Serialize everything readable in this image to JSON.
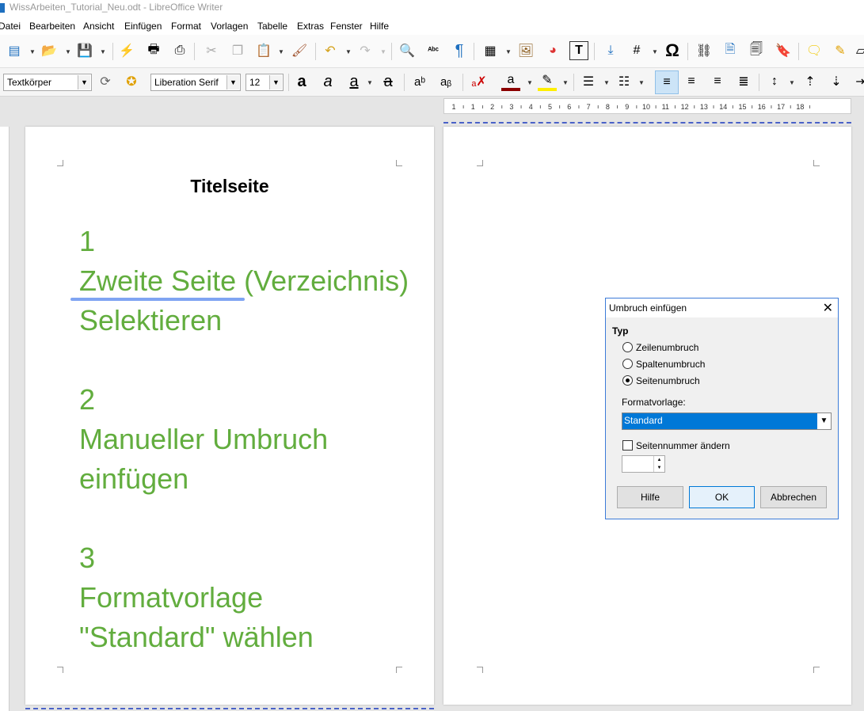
{
  "window": {
    "title": "WissArbeiten_Tutorial_Neu.odt - LibreOffice Writer"
  },
  "menu": [
    "Datei",
    "Bearbeiten",
    "Ansicht",
    "Einfügen",
    "Format",
    "Vorlagen",
    "Tabelle",
    "Extras",
    "Fenster",
    "Hilfe"
  ],
  "formatting": {
    "paragraph_style": "Textkörper",
    "font_name": "Liberation Serif",
    "font_size": "12"
  },
  "ruler": [
    "1",
    "1",
    "2",
    "3",
    "4",
    "5",
    "6",
    "7",
    "8",
    "9",
    "10",
    "11",
    "12",
    "13",
    "14",
    "15",
    "16",
    "17",
    "18"
  ],
  "document": {
    "title": "Titelseite",
    "steps": [
      {
        "num": "1",
        "line1_a": "Zweite Seite",
        "line1_b": " (Verzeichnis)",
        "line2": "Selektieren"
      },
      {
        "num": "2",
        "line1": "Manueller Umbruch",
        "line2": "einfügen"
      },
      {
        "num": "3",
        "line1": "Formatvorlage",
        "line2": "\"Standard\" wählen"
      }
    ]
  },
  "dialog": {
    "title": "Umbruch einfügen",
    "type_label": "Typ",
    "options": [
      "Zeilenumbruch",
      "Spaltenumbruch",
      "Seitenumbruch"
    ],
    "selected_option": "Seitenumbruch",
    "format_label": "Formatvorlage:",
    "format_value": "Standard",
    "page_number_label": "Seitennummer ändern",
    "buttons": {
      "help": "Hilfe",
      "ok": "OK",
      "cancel": "Abbrechen"
    }
  },
  "colors": {
    "accent_text": "#62ad3e",
    "selection": "#0078d7",
    "annotation_stroke": "#7fa4f2"
  }
}
